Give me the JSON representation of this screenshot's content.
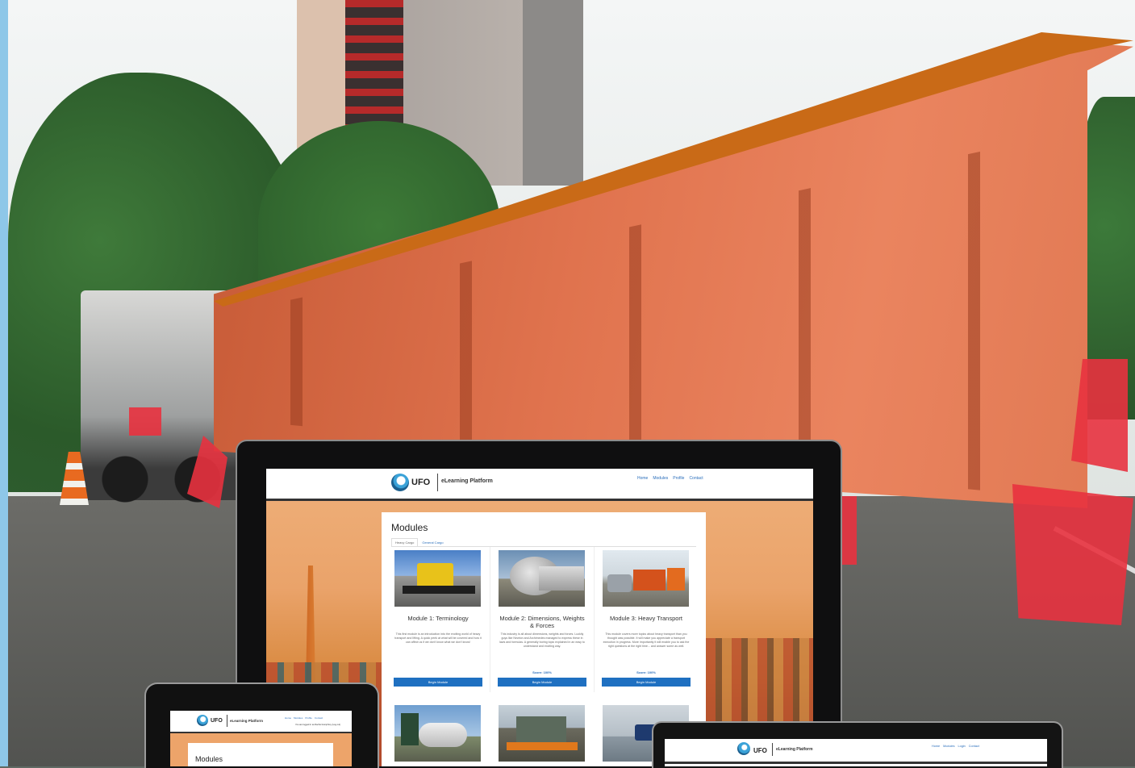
{
  "desktop": {
    "logo_text": "UFO",
    "platform_title": "eLearning Platform",
    "nav": [
      "Home",
      "Modules",
      "Profile",
      "Contact"
    ],
    "page_title": "Modules",
    "tabs": [
      "Heavy Cargo",
      "General Cargo"
    ],
    "modules": [
      {
        "title": "Module 1: Terminology",
        "description": "This first module is an introduction into the exciting world of heavy transport and lifting. A quick peek at what will be covered and how it can affect us if we don't know what we don't know!",
        "score": "",
        "button": "Begin Module"
      },
      {
        "title": "Module 2: Dimensions, Weights & Forces",
        "description": "This industry is all about dimensions, weights and forces. Luckily guys like Newton and Archimedes managed to express these in laws and formulas. A generally boring topic explained in an easy to understand and exciting way.",
        "score": "Score: 100%",
        "button": "Begin Module"
      },
      {
        "title": "Module 3: Heavy Transport",
        "description": "This module covers more topics about heavy transport than you thought was possible. It will make you appreciate a transport execution in progress. More importantly it will enable you to ask the right questions at the right time... and answer some as well.",
        "score": "Score: 100%",
        "button": "Begin Module"
      }
    ]
  },
  "tablet": {
    "logo_text": "UFO",
    "platform_title": "eLearning Platform",
    "nav": [
      "Home",
      "Modules",
      "Profile",
      "Contact"
    ],
    "status": "You are logged in as Rachel Humphrey (Log out)",
    "page_title": "Modules"
  },
  "laptop": {
    "logo_text": "UFO",
    "platform_title": "eLearning Platform",
    "nav": [
      "Home",
      "Modules",
      "Login",
      "Contact"
    ]
  },
  "colors": {
    "accent_blue": "#1f70c1",
    "link_blue": "#2a6ebb",
    "side_bar": "#8ec7e8"
  }
}
